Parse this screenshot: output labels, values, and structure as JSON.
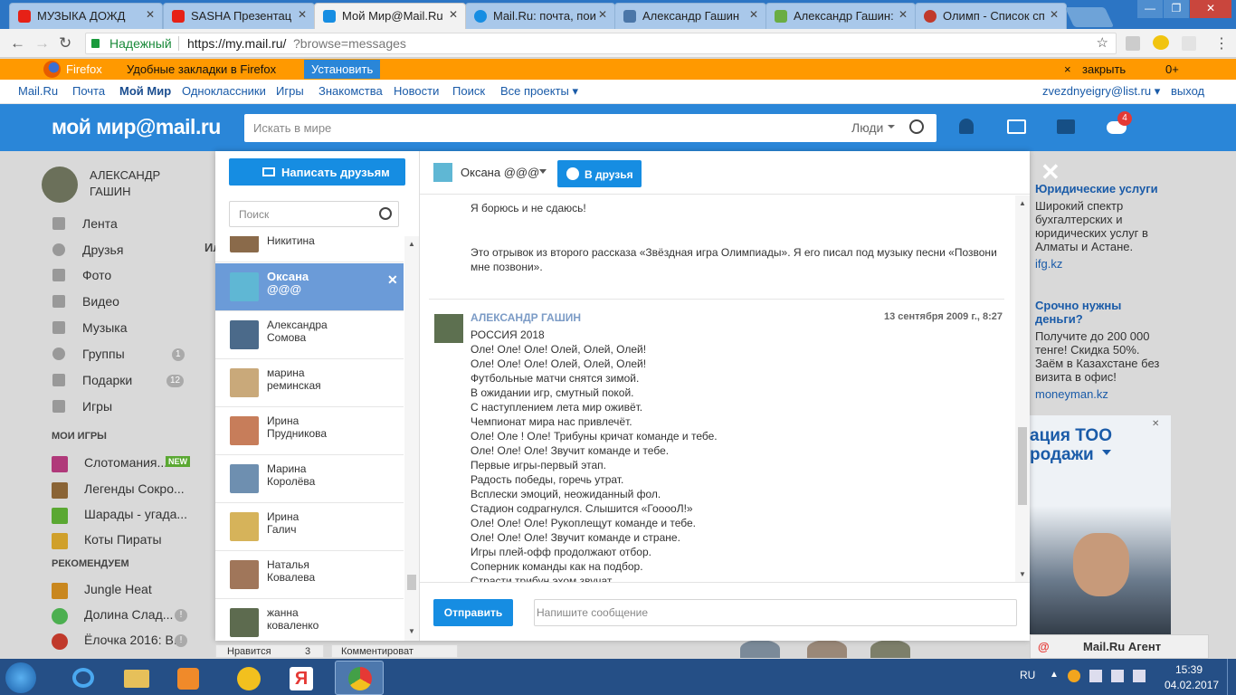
{
  "browser": {
    "tabs": [
      {
        "title": "МУЗЫКА ДОЖД",
        "favicon_color": "#e62117",
        "muted": true
      },
      {
        "title": "SASHA Презентац",
        "favicon_color": "#e62117"
      },
      {
        "title": "Мой Мир@Mail.Ru",
        "favicon_color": "#168de2",
        "active": true
      },
      {
        "title": "Mail.Ru: почта, пои",
        "favicon_color": "#168de2"
      },
      {
        "title": "Александр Гашин",
        "favicon_color": "#4a76a8"
      },
      {
        "title": "Александр Гашин:",
        "favicon_color": "#6aad43"
      },
      {
        "title": "Олимп - Список сп",
        "favicon_color": "#c0392b"
      }
    ],
    "secure_label": "Надежный",
    "url_host": "https://my.mail.ru/",
    "url_path": "?browse=messages",
    "window_controls": {
      "minimize": "—",
      "maximize": "❐",
      "close": "✕"
    }
  },
  "firefox_bar": {
    "brand": "Firefox",
    "text": "Удобные закладки в Firefox",
    "install": "Установить",
    "close_x": "×",
    "close": "закрыть",
    "rating": "0+"
  },
  "portal_nav": {
    "items": [
      "Mail.Ru",
      "Почта",
      "Мой Мир",
      "Одноклассники",
      "Игры",
      "Знакомства",
      "Новости",
      "Поиск",
      "Все проекты ▾"
    ],
    "email": "zvezdnyeigry@list.ru ▾",
    "logout": "выход"
  },
  "header": {
    "logo": "мой мир@mail.ru",
    "search_placeholder": "Искать в мире",
    "search_scope": "Люди",
    "games_badge": "4"
  },
  "sidebar": {
    "user_name_1": "АЛЕКСАНДР",
    "user_name_2": "ГАШИН",
    "menu": [
      {
        "label": "Лента"
      },
      {
        "label": "Друзья"
      },
      {
        "label": "Фото"
      },
      {
        "label": "Видео"
      },
      {
        "label": "Музыка"
      },
      {
        "label": "Группы",
        "badge": "1"
      },
      {
        "label": "Подарки",
        "badge": "12"
      },
      {
        "label": "Игры"
      }
    ],
    "my_games_title": "МОИ ИГРЫ",
    "my_games": [
      {
        "label": "Слотомания...",
        "badge": "NEW"
      },
      {
        "label": "Легенды Сокро..."
      },
      {
        "label": "Шарады - угада..."
      },
      {
        "label": "Коты Пираты"
      }
    ],
    "recommended_title": "РЕКОМЕНДУЕМ",
    "recommended": [
      {
        "label": "Jungle Heat"
      },
      {
        "label": "Долина Слад...",
        "badge": "!"
      },
      {
        "label": "Ёлочка 2016: В...",
        "badge": "!"
      }
    ],
    "cut_letters": "Ил"
  },
  "modal": {
    "write_friends": "Написать друзьям",
    "search_placeholder": "Поиск",
    "contacts": [
      {
        "name": "Любовь\nНикитина",
        "color": "#8a6a4a"
      },
      {
        "name": "Оксана\n@@@",
        "color": "#5fb7d4",
        "selected": true
      },
      {
        "name": "Александра\nСомова",
        "color": "#4b6a8a"
      },
      {
        "name": "марина\nреминская",
        "color": "#c9a97a"
      },
      {
        "name": "Ирина\nПрудникова",
        "color": "#c77d5a"
      },
      {
        "name": "Марина\nКоролёва",
        "color": "#6e8fb0"
      },
      {
        "name": "Ирина\nГалич",
        "color": "#d6b35a"
      },
      {
        "name": "Наталья\nКовалева",
        "color": "#a0765a"
      },
      {
        "name": "жанна\nковаленко",
        "color": "#5d6b4f"
      }
    ],
    "chat_with": "Оксана @@@",
    "add_friend": "В друзья",
    "close": "✕",
    "msg1_lines": [
      "Я борюсь и не сдаюсь!"
    ],
    "msg1_para": "Это отрывок из второго рассказа «Звёздная игра Олимпиады». Я его писал под музыку песни «Позвони мне позвони».",
    "msg2_author": "АЛЕКСАНДР ГАШИН",
    "msg2_date": "13 сентября 2009 г., 8:27",
    "msg2_lines": [
      "РОССИЯ 2018",
      "Оле! Оле! Оле! Олей, Олей, Олей!",
      "Оле! Оле! Оле! Олей, Олей, Олей!",
      "Футбольные матчи снятся зимой.",
      "В ожидании игр, смутный покой.",
      "С наступлением лета мир оживёт.",
      "Чемпионат мира нас привлечёт.",
      "Оле! Оле ! Оле! Трибуны кричат команде и тебе.",
      "Оле! Оле! Оле! Звучит команде и тебе.",
      "Первые игры-первый этап.",
      "Радость победы, горечь утрат.",
      "Всплески эмоций, неожиданный фол.",
      "Стадион содрагнулся. Слышится «ГооооЛ!»",
      "Оле! Оле! Оле! Рукоплещут команде и тебе.",
      "Оле! Оле! Оле! Звучит команде и стране.",
      "Игры плей-офф продолжают отбор.",
      "Соперник команды как на подбор.",
      "Страсти трибун эхом звучат."
    ],
    "send": "Отправить",
    "message_placeholder": "Напишите сообщение"
  },
  "right_ads": {
    "ad1_title": "Юридические услуги",
    "ad1_text": "Широкий спектр бухгалтерских и юридических услуг в Алматы и Астане.",
    "ad1_link": "ifg.kz",
    "ad2_title": "Срочно нужны деньги?",
    "ad2_text": "Получите до 200 000 тенге! Скидка 50%. Заём в Казахстане без визита в офис!",
    "ad2_link": "moneyman.kz",
    "banner_line1": "ация ТОО",
    "banner_line2": "родажи",
    "banner_close": "✕"
  },
  "bottom_peek": {
    "like": "Нравится",
    "like_count": "3",
    "comment": "Комментироват"
  },
  "agent": {
    "label": "Mail.Ru Агент"
  },
  "taskbar": {
    "lang": "RU",
    "time": "15:39",
    "date": "04.02.2017"
  }
}
